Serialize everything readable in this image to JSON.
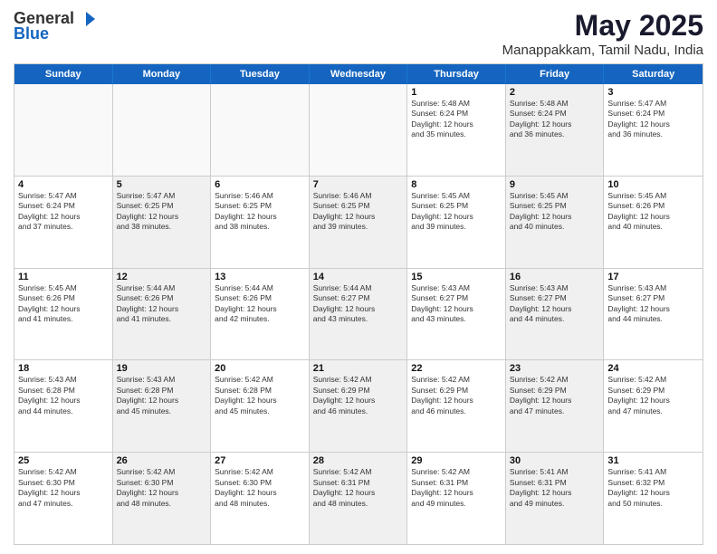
{
  "header": {
    "logo_general": "General",
    "logo_blue": "Blue",
    "month_title": "May 2025",
    "location": "Manappakkam, Tamil Nadu, India"
  },
  "days_of_week": [
    "Sunday",
    "Monday",
    "Tuesday",
    "Wednesday",
    "Thursday",
    "Friday",
    "Saturday"
  ],
  "weeks": [
    [
      {
        "day": "",
        "empty": true
      },
      {
        "day": "",
        "empty": true
      },
      {
        "day": "",
        "empty": true
      },
      {
        "day": "",
        "empty": true
      },
      {
        "day": "1",
        "lines": [
          "Sunrise: 5:48 AM",
          "Sunset: 6:24 PM",
          "Daylight: 12 hours",
          "and 35 minutes."
        ]
      },
      {
        "day": "2",
        "lines": [
          "Sunrise: 5:48 AM",
          "Sunset: 6:24 PM",
          "Daylight: 12 hours",
          "and 36 minutes."
        ],
        "shaded": true
      },
      {
        "day": "3",
        "lines": [
          "Sunrise: 5:47 AM",
          "Sunset: 6:24 PM",
          "Daylight: 12 hours",
          "and 36 minutes."
        ]
      }
    ],
    [
      {
        "day": "4",
        "lines": [
          "Sunrise: 5:47 AM",
          "Sunset: 6:24 PM",
          "Daylight: 12 hours",
          "and 37 minutes."
        ]
      },
      {
        "day": "5",
        "lines": [
          "Sunrise: 5:47 AM",
          "Sunset: 6:25 PM",
          "Daylight: 12 hours",
          "and 38 minutes."
        ],
        "shaded": true
      },
      {
        "day": "6",
        "lines": [
          "Sunrise: 5:46 AM",
          "Sunset: 6:25 PM",
          "Daylight: 12 hours",
          "and 38 minutes."
        ]
      },
      {
        "day": "7",
        "lines": [
          "Sunrise: 5:46 AM",
          "Sunset: 6:25 PM",
          "Daylight: 12 hours",
          "and 39 minutes."
        ],
        "shaded": true
      },
      {
        "day": "8",
        "lines": [
          "Sunrise: 5:45 AM",
          "Sunset: 6:25 PM",
          "Daylight: 12 hours",
          "and 39 minutes."
        ]
      },
      {
        "day": "9",
        "lines": [
          "Sunrise: 5:45 AM",
          "Sunset: 6:25 PM",
          "Daylight: 12 hours",
          "and 40 minutes."
        ],
        "shaded": true
      },
      {
        "day": "10",
        "lines": [
          "Sunrise: 5:45 AM",
          "Sunset: 6:26 PM",
          "Daylight: 12 hours",
          "and 40 minutes."
        ]
      }
    ],
    [
      {
        "day": "11",
        "lines": [
          "Sunrise: 5:45 AM",
          "Sunset: 6:26 PM",
          "Daylight: 12 hours",
          "and 41 minutes."
        ]
      },
      {
        "day": "12",
        "lines": [
          "Sunrise: 5:44 AM",
          "Sunset: 6:26 PM",
          "Daylight: 12 hours",
          "and 41 minutes."
        ],
        "shaded": true
      },
      {
        "day": "13",
        "lines": [
          "Sunrise: 5:44 AM",
          "Sunset: 6:26 PM",
          "Daylight: 12 hours",
          "and 42 minutes."
        ]
      },
      {
        "day": "14",
        "lines": [
          "Sunrise: 5:44 AM",
          "Sunset: 6:27 PM",
          "Daylight: 12 hours",
          "and 43 minutes."
        ],
        "shaded": true
      },
      {
        "day": "15",
        "lines": [
          "Sunrise: 5:43 AM",
          "Sunset: 6:27 PM",
          "Daylight: 12 hours",
          "and 43 minutes."
        ]
      },
      {
        "day": "16",
        "lines": [
          "Sunrise: 5:43 AM",
          "Sunset: 6:27 PM",
          "Daylight: 12 hours",
          "and 44 minutes."
        ],
        "shaded": true
      },
      {
        "day": "17",
        "lines": [
          "Sunrise: 5:43 AM",
          "Sunset: 6:27 PM",
          "Daylight: 12 hours",
          "and 44 minutes."
        ]
      }
    ],
    [
      {
        "day": "18",
        "lines": [
          "Sunrise: 5:43 AM",
          "Sunset: 6:28 PM",
          "Daylight: 12 hours",
          "and 44 minutes."
        ]
      },
      {
        "day": "19",
        "lines": [
          "Sunrise: 5:43 AM",
          "Sunset: 6:28 PM",
          "Daylight: 12 hours",
          "and 45 minutes."
        ],
        "shaded": true
      },
      {
        "day": "20",
        "lines": [
          "Sunrise: 5:42 AM",
          "Sunset: 6:28 PM",
          "Daylight: 12 hours",
          "and 45 minutes."
        ]
      },
      {
        "day": "21",
        "lines": [
          "Sunrise: 5:42 AM",
          "Sunset: 6:29 PM",
          "Daylight: 12 hours",
          "and 46 minutes."
        ],
        "shaded": true
      },
      {
        "day": "22",
        "lines": [
          "Sunrise: 5:42 AM",
          "Sunset: 6:29 PM",
          "Daylight: 12 hours",
          "and 46 minutes."
        ]
      },
      {
        "day": "23",
        "lines": [
          "Sunrise: 5:42 AM",
          "Sunset: 6:29 PM",
          "Daylight: 12 hours",
          "and 47 minutes."
        ],
        "shaded": true
      },
      {
        "day": "24",
        "lines": [
          "Sunrise: 5:42 AM",
          "Sunset: 6:29 PM",
          "Daylight: 12 hours",
          "and 47 minutes."
        ]
      }
    ],
    [
      {
        "day": "25",
        "lines": [
          "Sunrise: 5:42 AM",
          "Sunset: 6:30 PM",
          "Daylight: 12 hours",
          "and 47 minutes."
        ]
      },
      {
        "day": "26",
        "lines": [
          "Sunrise: 5:42 AM",
          "Sunset: 6:30 PM",
          "Daylight: 12 hours",
          "and 48 minutes."
        ],
        "shaded": true
      },
      {
        "day": "27",
        "lines": [
          "Sunrise: 5:42 AM",
          "Sunset: 6:30 PM",
          "Daylight: 12 hours",
          "and 48 minutes."
        ]
      },
      {
        "day": "28",
        "lines": [
          "Sunrise: 5:42 AM",
          "Sunset: 6:31 PM",
          "Daylight: 12 hours",
          "and 48 minutes."
        ],
        "shaded": true
      },
      {
        "day": "29",
        "lines": [
          "Sunrise: 5:42 AM",
          "Sunset: 6:31 PM",
          "Daylight: 12 hours",
          "and 49 minutes."
        ]
      },
      {
        "day": "30",
        "lines": [
          "Sunrise: 5:41 AM",
          "Sunset: 6:31 PM",
          "Daylight: 12 hours",
          "and 49 minutes."
        ],
        "shaded": true
      },
      {
        "day": "31",
        "lines": [
          "Sunrise: 5:41 AM",
          "Sunset: 6:32 PM",
          "Daylight: 12 hours",
          "and 50 minutes."
        ]
      }
    ]
  ]
}
